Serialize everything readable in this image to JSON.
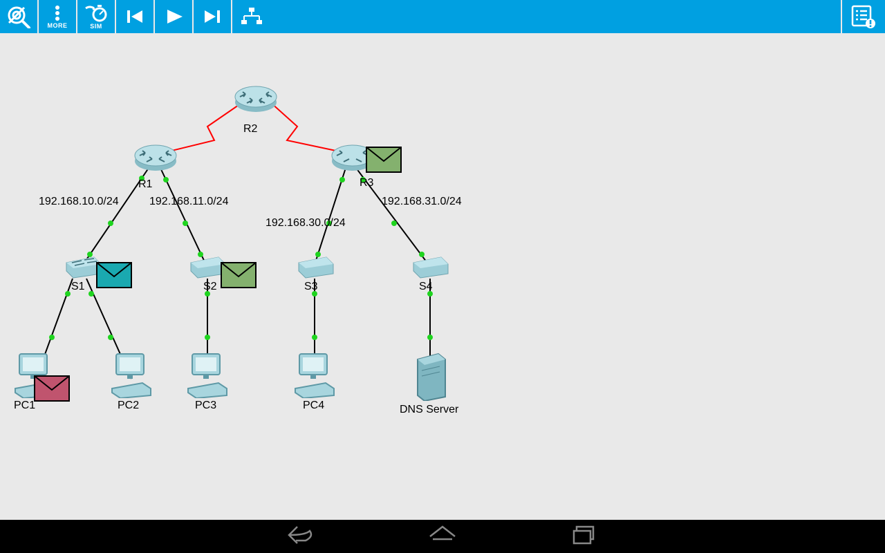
{
  "toolbar": {
    "zoom_label": "",
    "more_label": "MORE",
    "sim_label": "SIM"
  },
  "devices": {
    "R1": "R1",
    "R2": "R2",
    "R3": "R3",
    "S1": "S1",
    "S2": "S2",
    "S3": "S3",
    "S4": "S4",
    "PC1": "PC1",
    "PC2": "PC2",
    "PC3": "PC3",
    "PC4": "PC4",
    "DNS": "DNS Server"
  },
  "subnets": {
    "n1": "192.168.10.0/24",
    "n2": "192.168.11.0/24",
    "n3": "192.168.30.0/24",
    "n4": "192.168.31.0/24"
  },
  "packets": [
    {
      "at": "PC1",
      "color": "#c0546e"
    },
    {
      "at": "S1",
      "color": "#1aa9b0"
    },
    {
      "at": "S2",
      "color": "#6fa45e"
    },
    {
      "at": "R3",
      "color": "#6fa45e"
    }
  ],
  "colors": {
    "toolbar": "#00a0e1",
    "link_up": "#1fd41f",
    "serial": "#ff0000",
    "device_fill": "#a8d5de",
    "device_stroke": "#5e99a6"
  }
}
